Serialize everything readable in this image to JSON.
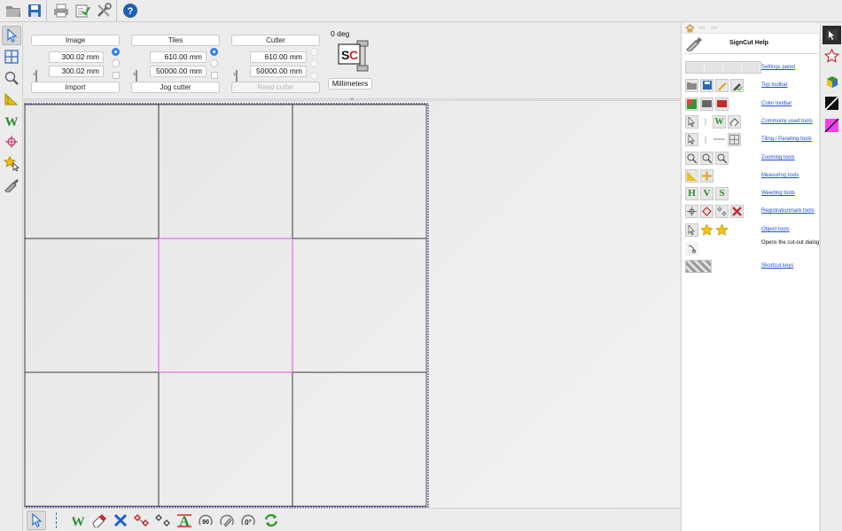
{
  "top_toolbar": {
    "icons": [
      "open-icon",
      "save-icon",
      "print-icon",
      "checklist-icon",
      "tools-icon",
      "help-icon"
    ]
  },
  "left_toolbar": {
    "icons": [
      "select-arrow-icon",
      "tiling-icon",
      "zoom-icon",
      "measure-icon",
      "weed-icon",
      "registration-mark-icon",
      "object-star-icon",
      "cutter-knife-icon"
    ]
  },
  "settings": {
    "image": {
      "title": "Image",
      "x_value": "300.02 mm",
      "y_value": "300.02 mm",
      "action_label": "Import"
    },
    "tiles": {
      "title": "Tiles",
      "x_value": "610.00 mm",
      "y_value": "50000.00 mm",
      "action_label": "Jog cutter"
    },
    "cutter": {
      "title": "Cutter",
      "x_value": "610.00 mm",
      "y_value": "50000.00 mm",
      "action_label": "Read cutter"
    },
    "rotation": "0 deg",
    "units": "Millimeters"
  },
  "canvas": {
    "tile_columns": 3,
    "tile_rows": 3,
    "highlight_color": "#e64ce6",
    "sheet_border_color": "#2a2a8a"
  },
  "bottom_toolbar": {
    "icons": [
      "select-arrow-icon",
      "weed-icon",
      "eraser-icon",
      "delete-x-icon",
      "regmark-icon",
      "regmark-outline-icon",
      "text-a-icon",
      "rotate-90-icon",
      "rotate-knife-icon",
      "rotate-0-icon",
      "refresh-icon"
    ],
    "labels": {
      "rotate_90": "90",
      "rotate_0": "0°"
    }
  },
  "help": {
    "title": "SignCut Help",
    "items": [
      {
        "link": "Settings panel"
      },
      {
        "link": "Top toolbar"
      },
      {
        "link": "Color toolbar"
      },
      {
        "link": "Commonly used tools"
      },
      {
        "link": "Tiling / Paneling tools"
      },
      {
        "link": "Zooming tools"
      },
      {
        "link": "Measuring tools"
      },
      {
        "link": "Weeding tools"
      },
      {
        "link": "Registrationmark tools"
      },
      {
        "link": "Object tools"
      },
      {
        "text": "Opens the cut-out dialog"
      },
      {
        "link": "Shortcut keys"
      }
    ]
  },
  "right_strip": {
    "icons": [
      "node-tool-icon",
      "star-shape-icon",
      "color-cube-icon",
      "black-fill-icon",
      "magenta-fill-icon"
    ]
  },
  "colors": {
    "radio_selected": "#2f80ed",
    "link": "#1a4fd6",
    "weed_green": "#2e8b2e"
  }
}
